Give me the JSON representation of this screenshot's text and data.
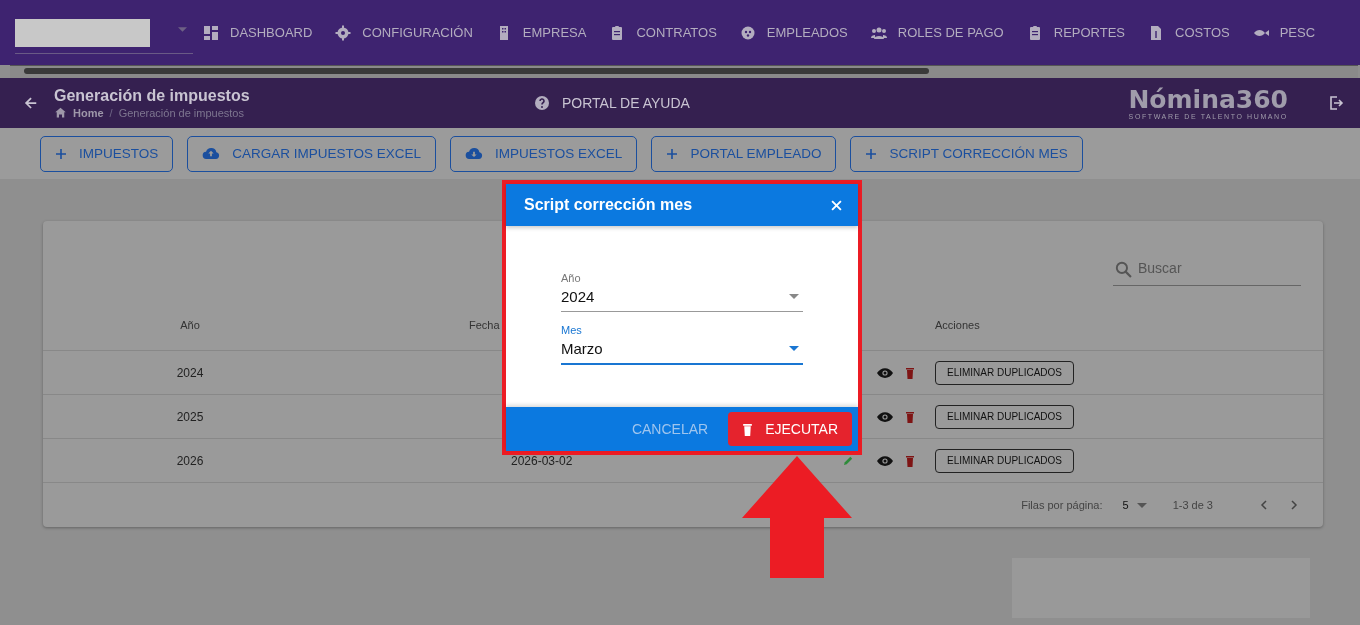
{
  "nav": {
    "items": [
      {
        "label": "DASHBOARD"
      },
      {
        "label": "CONFIGURACIÓN"
      },
      {
        "label": "EMPRESA"
      },
      {
        "label": "CONTRATOS"
      },
      {
        "label": "EMPLEADOS"
      },
      {
        "label": "ROLES DE PAGO"
      },
      {
        "label": "REPORTES"
      },
      {
        "label": "COSTOS"
      },
      {
        "label": "PESC"
      }
    ]
  },
  "header": {
    "title": "Generación de impuestos",
    "breadcrumb": [
      "Home",
      "Generación de impuestos"
    ],
    "breadcrumb_separator": "/",
    "help": "PORTAL DE AYUDA",
    "logo": "Nómina360",
    "logo_tagline": "SOFTWARE DE TALENTO HUMANO"
  },
  "toolbar": [
    {
      "label": "IMPUESTOS",
      "kind": "plus"
    },
    {
      "label": "CARGAR IMPUESTOS EXCEL",
      "kind": "upload"
    },
    {
      "label": "IMPUESTOS EXCEL",
      "kind": "download"
    },
    {
      "label": "PORTAL EMPLEADO",
      "kind": "plus"
    },
    {
      "label": "SCRIPT CORRECCIÓN MES",
      "kind": "plus"
    }
  ],
  "table": {
    "search": {
      "placeholder": "Buscar"
    },
    "columns": [
      "Año",
      "Fecha",
      "Acciones"
    ],
    "rows": [
      {
        "year": "2024",
        "action": "ELIMINAR DUPLICADOS"
      },
      {
        "year": "2025",
        "action": "ELIMINAR DUPLICADOS"
      },
      {
        "year": "2026",
        "fecha": "2026-03-02",
        "action": "ELIMINAR DUPLICADOS"
      }
    ],
    "pagination": {
      "rows_label": "Filas por página:",
      "rows_value": "5",
      "range": "1-3 de 3"
    }
  },
  "dialog": {
    "title": "Script corrección mes",
    "fields": [
      {
        "label": "Año",
        "value": "2024",
        "focused": false
      },
      {
        "label": "Mes",
        "value": "Marzo",
        "focused": true
      }
    ],
    "cancel": "CANCELAR",
    "confirm": "EJECUTAR"
  }
}
